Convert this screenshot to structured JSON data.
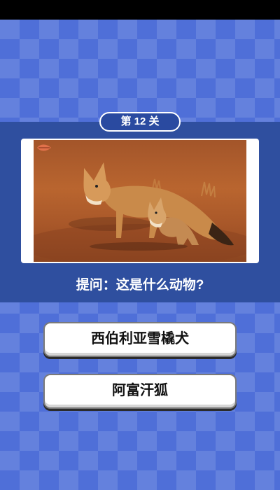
{
  "level": {
    "label": "第 12 关"
  },
  "question": {
    "text": "提问：这是什么动物?"
  },
  "photo": {
    "subject": "fox-and-kit-photo"
  },
  "answers": [
    {
      "label": "西伯利亚雪橇犬"
    },
    {
      "label": "阿富汗狐"
    }
  ],
  "colors": {
    "background": "#4f6fd8",
    "band": "#2f4f9f",
    "pill": "#2a4aa0",
    "button": "#ffffff"
  }
}
